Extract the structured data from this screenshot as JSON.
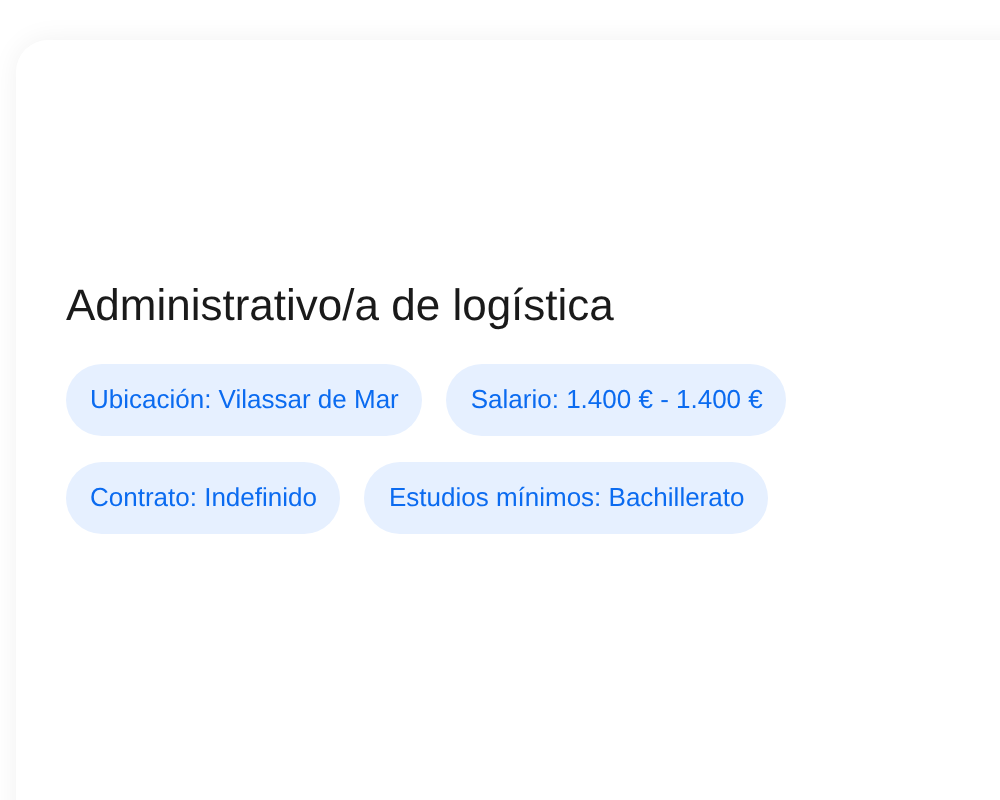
{
  "job": {
    "title": "Administrativo/a de logística",
    "tags": [
      "Ubicación: Vilassar de Mar",
      "Salario: 1.400 € - 1.400 €",
      "Contrato: Indefinido",
      "Estudios mínimos: Bachillerato"
    ]
  }
}
